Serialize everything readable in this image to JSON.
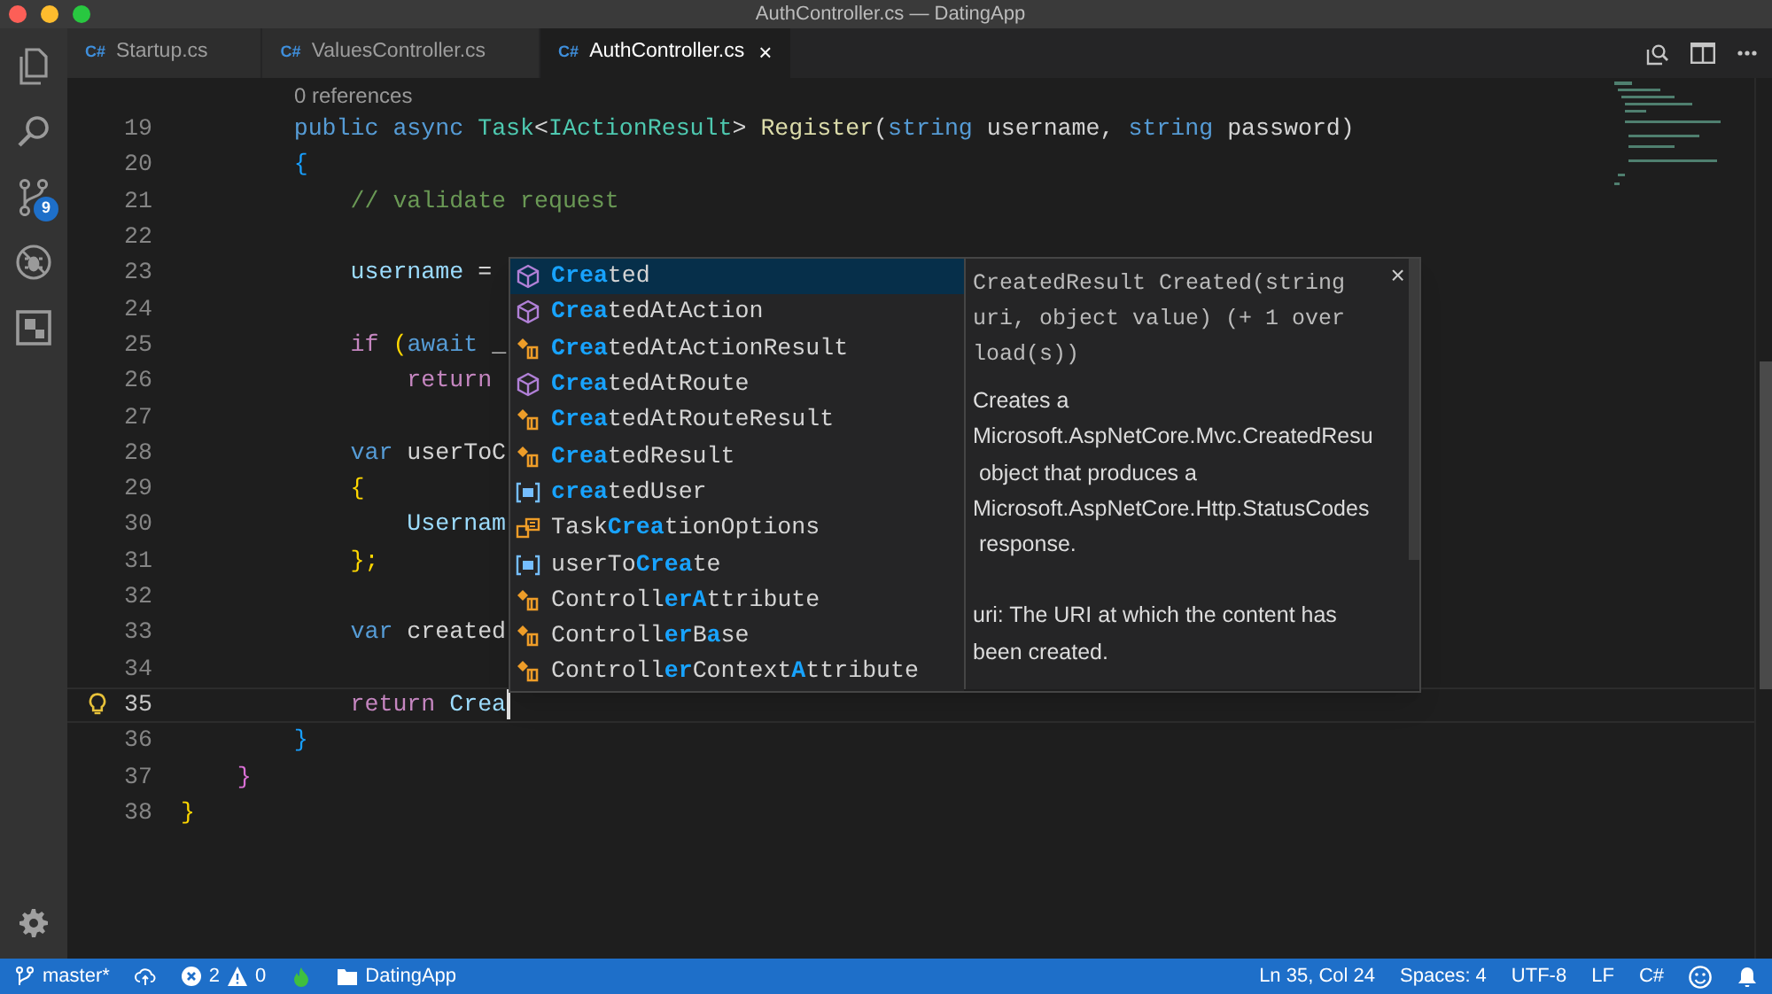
{
  "window": {
    "title": "AuthController.cs — DatingApp"
  },
  "activity_bar": {
    "items": [
      {
        "kind": "explorer"
      },
      {
        "kind": "search"
      },
      {
        "kind": "source-control",
        "badge": "9"
      },
      {
        "kind": "debug"
      },
      {
        "kind": "extensions"
      }
    ]
  },
  "tabs": [
    {
      "file_icon": "C#",
      "label": "Startup.cs",
      "selected": false
    },
    {
      "file_icon": "C#",
      "label": "ValuesController.cs",
      "selected": false
    },
    {
      "file_icon": "C#",
      "label": "AuthController.cs",
      "selected": true,
      "close_glyph": "×"
    }
  ],
  "editor": {
    "code_lens": "0 references",
    "lines": [
      {
        "number": "19",
        "current": false,
        "lightbulb": false,
        "tokens": [
          {
            "text": "        public ",
            "kind": "keyword"
          },
          {
            "text": "async ",
            "kind": "keyword"
          },
          {
            "text": "Task",
            "kind": "type"
          },
          {
            "text": "<",
            "kind": "plain"
          },
          {
            "text": "IActionResult",
            "kind": "type"
          },
          {
            "text": "> ",
            "kind": "plain"
          },
          {
            "text": "Register",
            "kind": "function"
          },
          {
            "text": "(",
            "kind": "plain"
          },
          {
            "text": "string",
            "kind": "keyword"
          },
          {
            "text": " username, ",
            "kind": "plain"
          },
          {
            "text": "string",
            "kind": "keyword"
          },
          {
            "text": " password)",
            "kind": "plain"
          }
        ]
      },
      {
        "number": "20",
        "current": false,
        "lightbulb": false,
        "tokens": [
          {
            "text": "        {",
            "kind": "brace3"
          }
        ]
      },
      {
        "number": "21",
        "current": false,
        "lightbulb": false,
        "tokens": [
          {
            "text": "            // validate request",
            "kind": "comment"
          }
        ]
      },
      {
        "number": "22",
        "current": false,
        "lightbulb": false
      },
      {
        "number": "23",
        "current": false,
        "lightbulb": false,
        "tokens": [
          {
            "text": "            username",
            "kind": "variable"
          },
          {
            "text": " =",
            "kind": "plain"
          }
        ]
      },
      {
        "number": "24",
        "current": false,
        "lightbulb": false
      },
      {
        "number": "25",
        "current": false,
        "lightbulb": false,
        "tokens": [
          {
            "text": "            if",
            "kind": "control"
          },
          {
            "text": " (",
            "kind": "brace1"
          },
          {
            "text": "await",
            "kind": "keyword"
          },
          {
            "text": " _",
            "kind": "plain"
          }
        ]
      },
      {
        "number": "26",
        "current": false,
        "lightbulb": false,
        "tokens": [
          {
            "text": "                return",
            "kind": "control"
          }
        ]
      },
      {
        "number": "27",
        "current": false,
        "lightbulb": false
      },
      {
        "number": "28",
        "current": false,
        "lightbulb": false,
        "tokens": [
          {
            "text": "            var",
            "kind": "keyword"
          },
          {
            "text": " userToC",
            "kind": "plain"
          }
        ]
      },
      {
        "number": "29",
        "current": false,
        "lightbulb": false,
        "tokens": [
          {
            "text": "            {",
            "kind": "brace1"
          }
        ]
      },
      {
        "number": "30",
        "current": false,
        "lightbulb": false,
        "tokens": [
          {
            "text": "                Usernam",
            "kind": "variable"
          }
        ]
      },
      {
        "number": "31",
        "current": false,
        "lightbulb": false,
        "tokens": [
          {
            "text": "            };",
            "kind": "brace1"
          }
        ]
      },
      {
        "number": "32",
        "current": false,
        "lightbulb": false
      },
      {
        "number": "33",
        "current": false,
        "lightbulb": false,
        "tokens": [
          {
            "text": "            var",
            "kind": "keyword"
          },
          {
            "text": " created",
            "kind": "plain"
          }
        ]
      },
      {
        "number": "34",
        "current": false,
        "lightbulb": false
      },
      {
        "number": "35",
        "current": true,
        "lightbulb": true,
        "tokens": [
          {
            "text": "            return ",
            "kind": "control"
          },
          {
            "text": "Crea",
            "kind": "variable"
          }
        ]
      },
      {
        "number": "36",
        "current": false,
        "lightbulb": false,
        "tokens": [
          {
            "text": "        }",
            "kind": "brace3"
          }
        ]
      },
      {
        "number": "37",
        "current": false,
        "lightbulb": false,
        "tokens": [
          {
            "text": "    }",
            "kind": "brace2"
          }
        ]
      },
      {
        "number": "38",
        "current": false,
        "lightbulb": false,
        "tokens": [
          {
            "text": "}",
            "kind": "brace1"
          }
        ]
      }
    ]
  },
  "suggest": {
    "items": [
      {
        "kind": "method",
        "label": "**Crea**ted",
        "selected": true
      },
      {
        "kind": "method",
        "label": "**Crea**tedAtAction",
        "selected": false
      },
      {
        "kind": "class",
        "label": "**Crea**tedAtActionResult",
        "selected": false
      },
      {
        "kind": "method",
        "label": "**Crea**tedAtRoute",
        "selected": false
      },
      {
        "kind": "class",
        "label": "**Crea**tedAtRouteResult",
        "selected": false
      },
      {
        "kind": "class",
        "label": "**Crea**tedResult",
        "selected": false
      },
      {
        "kind": "variable",
        "label": "**crea**tedUser",
        "selected": false
      },
      {
        "kind": "enum",
        "label": "Task**Crea**tionOptions",
        "selected": false
      },
      {
        "kind": "variable",
        "label": "userTo**Crea**te",
        "selected": false
      },
      {
        "kind": "class",
        "label": "Controll**erA**ttribute",
        "selected": false
      },
      {
        "kind": "class",
        "label": "Controll**er**B**a**se",
        "selected": false
      },
      {
        "kind": "class",
        "label": "Controll**er**Context**A**ttribute",
        "selected": false
      }
    ],
    "details": {
      "close_glyph": "×",
      "signature_lines": [
        "CreatedResult Created(string",
        "uri, object value) (+ 1 over",
        "load(s))"
      ],
      "description_lines": [
        "Creates a",
        "Microsoft.AspNetCore.Mvc.CreatedResu",
        " object that produces a",
        "Microsoft.AspNetCore.Http.StatusCodes",
        " response."
      ],
      "param_lines": [
        "uri: The URI at which the content has",
        "been created."
      ]
    }
  },
  "status_bar": {
    "branch": "master*",
    "errors": "2",
    "warnings": "0",
    "folder": "DatingApp",
    "position": "Ln 35, Col 24",
    "indentation": "Spaces: 4",
    "encoding": "UTF-8",
    "eol": "LF",
    "language": "C#"
  }
}
